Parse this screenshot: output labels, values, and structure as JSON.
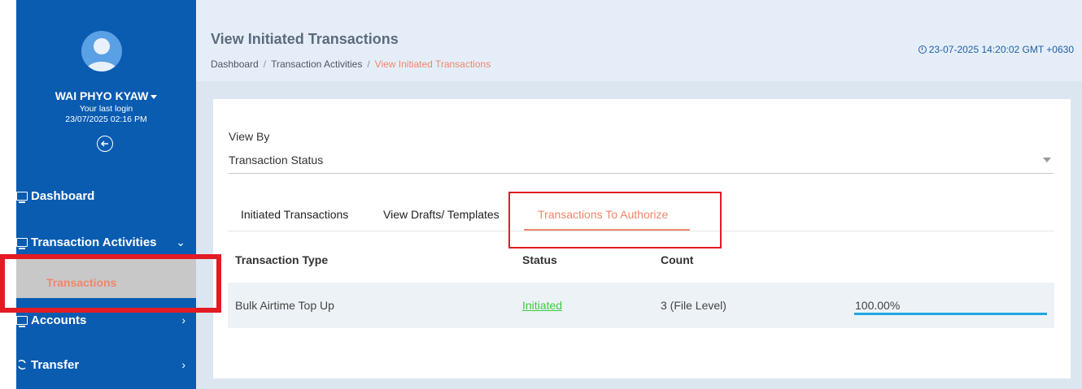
{
  "user": {
    "name": "WAI PHYO KYAW",
    "last_login_label": "Your last login",
    "last_login_value": "23/07/2025 02:16 PM"
  },
  "sidebar": {
    "items": [
      {
        "label": "Dashboard"
      },
      {
        "label": "Transaction Activities",
        "chevron": "⌄"
      },
      {
        "label": "Transactions"
      },
      {
        "label": "Accounts",
        "chevron": "›"
      },
      {
        "label": "Transfer",
        "chevron": "›"
      }
    ]
  },
  "header": {
    "title": "View Initiated Transactions",
    "breadcrumb": [
      "Dashboard",
      "Transaction Activities",
      "View Initiated Transactions"
    ],
    "separator": "/",
    "datetime": "23-07-2025 14:20:02 GMT +0630"
  },
  "filter": {
    "label": "View By",
    "selected": "Transaction Status"
  },
  "tabs": [
    {
      "label": "Initiated Transactions"
    },
    {
      "label": "View Drafts/ Templates"
    },
    {
      "label": "Transactions To Authorize"
    }
  ],
  "table": {
    "headers": [
      "Transaction Type",
      "Status",
      "Count"
    ],
    "rows": [
      {
        "type": "Bulk Airtime Top Up",
        "status": "Initiated",
        "count": "3 (File Level)",
        "progress_text": "100.00%",
        "progress": 1.0
      }
    ]
  },
  "colors": {
    "sidebar": "#0a5cb1",
    "accent": "#f0866a",
    "status_link": "#3ccd3c",
    "progress": "#1ea7e1",
    "highlight": "#e31b23"
  }
}
